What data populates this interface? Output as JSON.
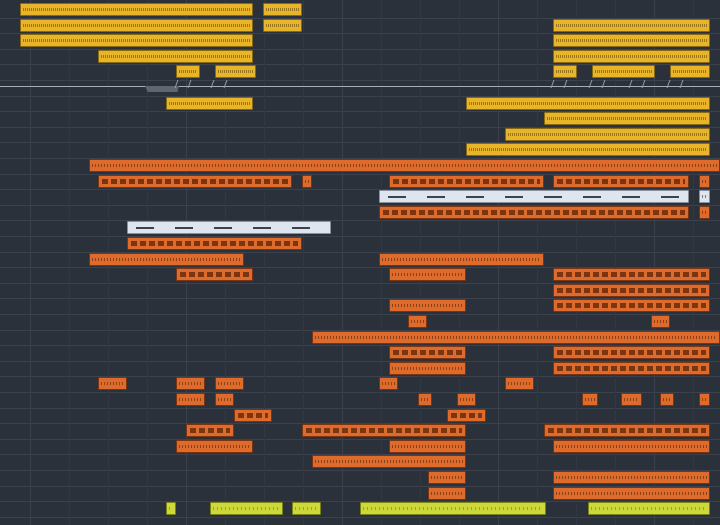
{
  "colors": {
    "background": "#2b313b",
    "grid_line": "#3b424d",
    "clip_yellow": "#e8b52a",
    "clip_orange": "#de6a2c",
    "clip_white": "#dfe5ee",
    "clip_lime": "#cdd83a",
    "automation": "#a8adb4"
  },
  "arrangement": {
    "view": "playlist-arrangement",
    "track_count": 33,
    "clip_color_groups": [
      "yellow",
      "orange",
      "white",
      "lime"
    ]
  }
}
